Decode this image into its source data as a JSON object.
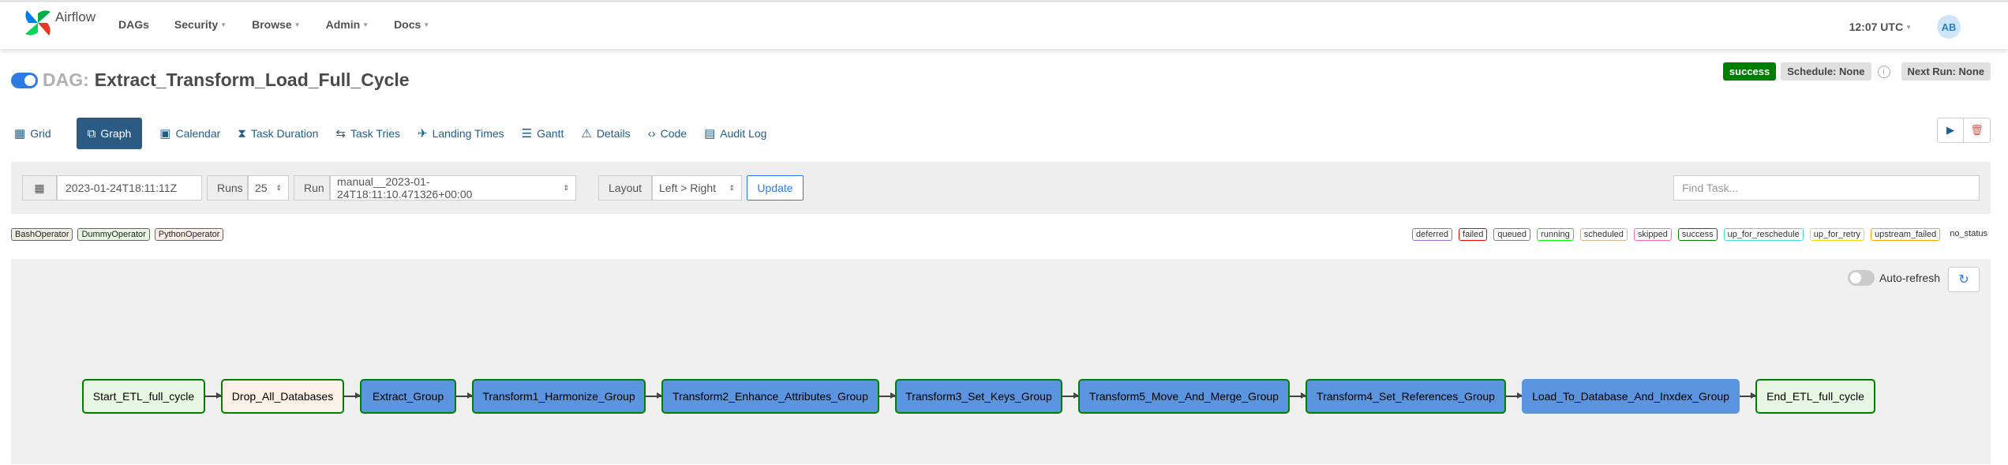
{
  "navbar": {
    "brand": "Airflow",
    "items": [
      {
        "label": "DAGs",
        "dropdown": false
      },
      {
        "label": "Security",
        "dropdown": true
      },
      {
        "label": "Browse",
        "dropdown": true
      },
      {
        "label": "Admin",
        "dropdown": true
      },
      {
        "label": "Docs",
        "dropdown": true
      }
    ],
    "time": "12:07 UTC",
    "avatar": "AB"
  },
  "dag": {
    "prefix": "DAG:",
    "id": "Extract_Transform_Load_Full_Cycle",
    "paused": false
  },
  "header": {
    "status": "success",
    "schedule": "Schedule: None",
    "next_run": "Next Run: None"
  },
  "tabs": [
    {
      "label": "Grid",
      "icon": "grid-icon"
    },
    {
      "label": "Graph",
      "icon": "graph-icon",
      "active": true
    },
    {
      "label": "Calendar",
      "icon": "calendar-icon"
    },
    {
      "label": "Task Duration",
      "icon": "hourglass-icon"
    },
    {
      "label": "Task Tries",
      "icon": "retry-icon"
    },
    {
      "label": "Landing Times",
      "icon": "plane-icon"
    },
    {
      "label": "Gantt",
      "icon": "gantt-icon"
    },
    {
      "label": "Details",
      "icon": "warning-triangle-icon"
    },
    {
      "label": "Code",
      "icon": "code-icon"
    },
    {
      "label": "Audit Log",
      "icon": "file-icon"
    }
  ],
  "filters": {
    "base_date": "2023-01-24T18:11:11Z",
    "runs_label": "Runs",
    "runs_value": "25",
    "run_label": "Run",
    "run_value": "manual__2023-01-24T18:11:10.471326+00:00",
    "layout_label": "Layout",
    "layout_value": "Left > Right",
    "update_label": "Update",
    "find_task_placeholder": "Find Task..."
  },
  "operators": [
    {
      "name": "BashOperator",
      "color": "#f0ede4"
    },
    {
      "name": "DummyOperator",
      "color": "#e8f7e4"
    },
    {
      "name": "PythonOperator",
      "color": "#ffefeb"
    }
  ],
  "states": [
    {
      "name": "deferred",
      "color": "#9370db"
    },
    {
      "name": "failed",
      "color": "#ff0000"
    },
    {
      "name": "queued",
      "color": "#808080"
    },
    {
      "name": "running",
      "color": "#00ff00"
    },
    {
      "name": "scheduled",
      "color": "#d2b48c"
    },
    {
      "name": "skipped",
      "color": "#ff69b4"
    },
    {
      "name": "success",
      "color": "#008000"
    },
    {
      "name": "up_for_reschedule",
      "color": "#40e0d0"
    },
    {
      "name": "up_for_retry",
      "color": "#ffd700"
    },
    {
      "name": "upstream_failed",
      "color": "#ffa500"
    },
    {
      "name": "no_status",
      "color": "none"
    }
  ],
  "graph": {
    "auto_refresh_label": "Auto-refresh",
    "auto_refresh": false,
    "nodes": [
      {
        "label": "Start_ETL_full_cycle",
        "fill": "#e8f7e4",
        "state": "success"
      },
      {
        "label": "Drop_All_Databases",
        "fill": "#fdf1e7",
        "state": "success"
      },
      {
        "label": "Extract_Group",
        "fill": "#5b95e0",
        "state": "success"
      },
      {
        "label": "Transform1_Harmonize_Group",
        "fill": "#5b95e0",
        "state": "success"
      },
      {
        "label": "Transform2_Enhance_Attributes_Group",
        "fill": "#5b95e0",
        "state": "success"
      },
      {
        "label": "Transform3_Set_Keys_Group",
        "fill": "#5b95e0",
        "state": "success"
      },
      {
        "label": "Transform5_Move_And_Merge_Group",
        "fill": "#5b95e0",
        "state": "success"
      },
      {
        "label": "Transform4_Set_References_Group",
        "fill": "#5b95e0",
        "state": "success"
      },
      {
        "label": "Load_To_Database_And_Inxdex_Group",
        "fill": "#5b95e0",
        "state": "no_status"
      },
      {
        "label": "End_ETL_full_cycle",
        "fill": "#e8f7e4",
        "state": "success"
      }
    ]
  }
}
